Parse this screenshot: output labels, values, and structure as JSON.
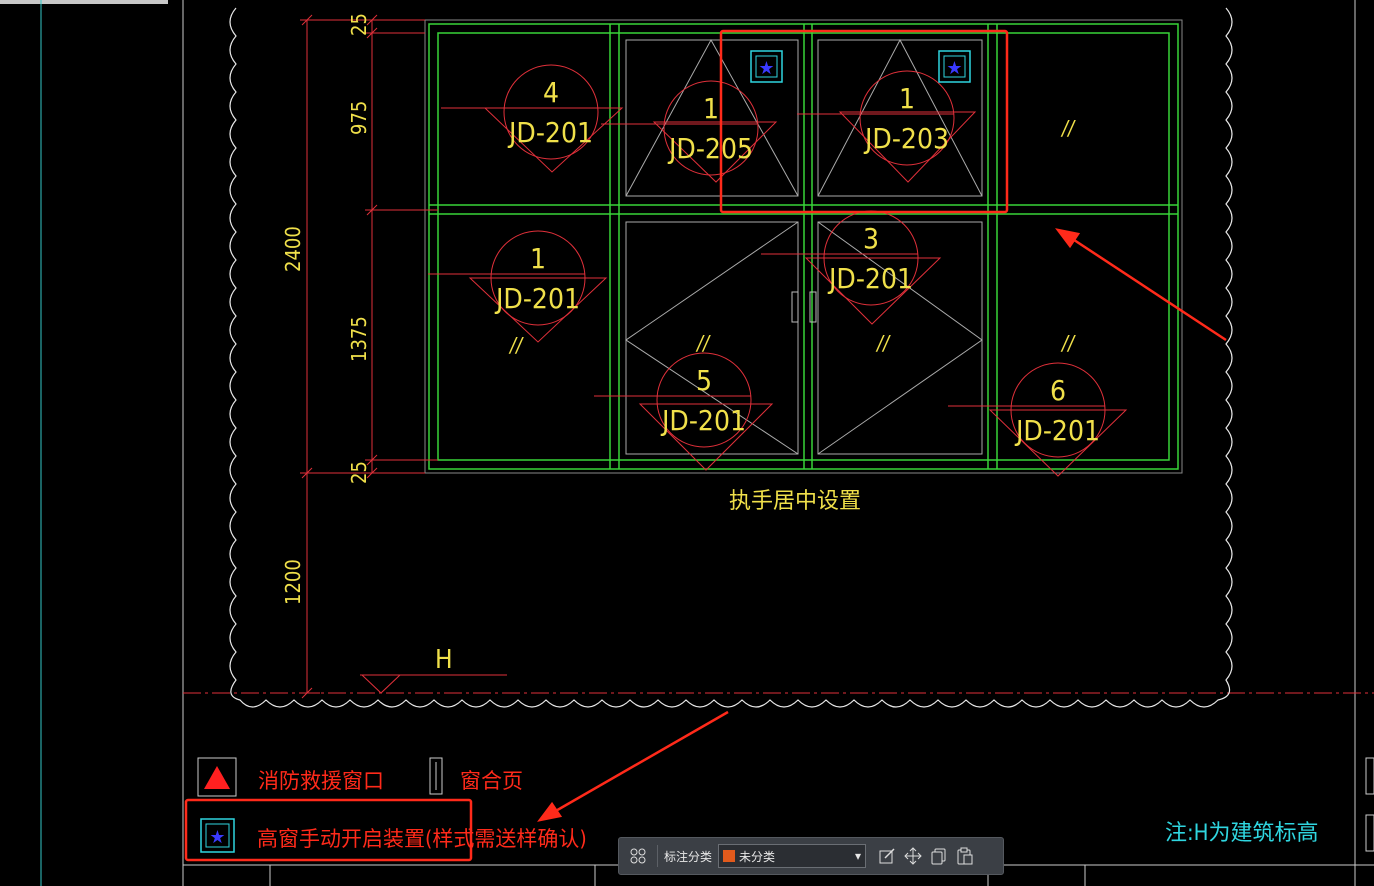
{
  "drawing": {
    "dimensions": {
      "d25_top": "25",
      "d975": "975",
      "d2400": "2400",
      "d1375": "1375",
      "d25_bottom": "25",
      "d1200": "1200"
    },
    "elevation_mark": "H",
    "handle_note": "执手居中设置",
    "panels": [
      {
        "num": "4",
        "code": "JD-201"
      },
      {
        "num": "1",
        "code": "JD-205"
      },
      {
        "num": "1",
        "code": "JD-203"
      },
      {
        "num": "1",
        "code": "JD-201"
      },
      {
        "num": "3",
        "code": "JD-201"
      },
      {
        "num": "5",
        "code": "JD-201"
      },
      {
        "num": "6",
        "code": "JD-201"
      }
    ],
    "glass_mark": "//",
    "legend": {
      "fire_rescue": "消防救援窗口",
      "hinge": "窗合页",
      "high_window": "高窗手动开启装置(样式需送样确认)"
    },
    "note": "注:H为建筑标高",
    "colors": {
      "frame": "#39d439",
      "dim": "#e0303a",
      "annotation_text": "#f0e04a",
      "redline": "#ff2a1a",
      "note_text": "#2fd6e0"
    }
  },
  "toolbar": {
    "category_label": "标注分类",
    "category_value": "未分类",
    "category_color": "#e25a1c"
  }
}
